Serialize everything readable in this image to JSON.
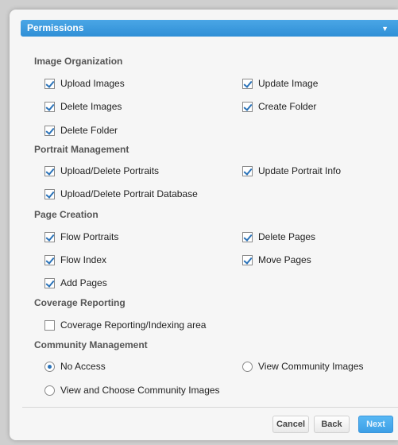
{
  "panel": {
    "title": "Permissions",
    "chevron": "▼"
  },
  "sections": {
    "image_organization": {
      "title": "Image Organization",
      "upload_images": "Upload Images",
      "update_image": "Update Image",
      "delete_images": "Delete Images",
      "create_folder": "Create Folder",
      "delete_folder": "Delete Folder"
    },
    "portrait_management": {
      "title": "Portrait Management",
      "upload_delete_portraits": "Upload/Delete Portraits",
      "update_portrait_info": "Update Portrait Info",
      "upload_delete_portrait_database": "Upload/Delete Portrait Database"
    },
    "page_creation": {
      "title": "Page Creation",
      "flow_portraits": "Flow Portraits",
      "delete_pages": "Delete Pages",
      "flow_index": "Flow Index",
      "move_pages": "Move Pages",
      "add_pages": "Add Pages"
    },
    "coverage_reporting": {
      "title": "Coverage Reporting",
      "coverage_reporting_indexing": "Coverage Reporting/Indexing area"
    },
    "community_management": {
      "title": "Community Management",
      "no_access": "No Access",
      "view_community_images": "View Community Images",
      "view_and_choose": "View and Choose Community Images",
      "selected": "No Access"
    }
  },
  "footer": {
    "cancel_label": "Cancel",
    "back_label": "Back",
    "next_label": "Next"
  },
  "colors": {
    "header": "#3a9ae0",
    "check": "#2a72b8",
    "next_button": "#4aacee"
  }
}
